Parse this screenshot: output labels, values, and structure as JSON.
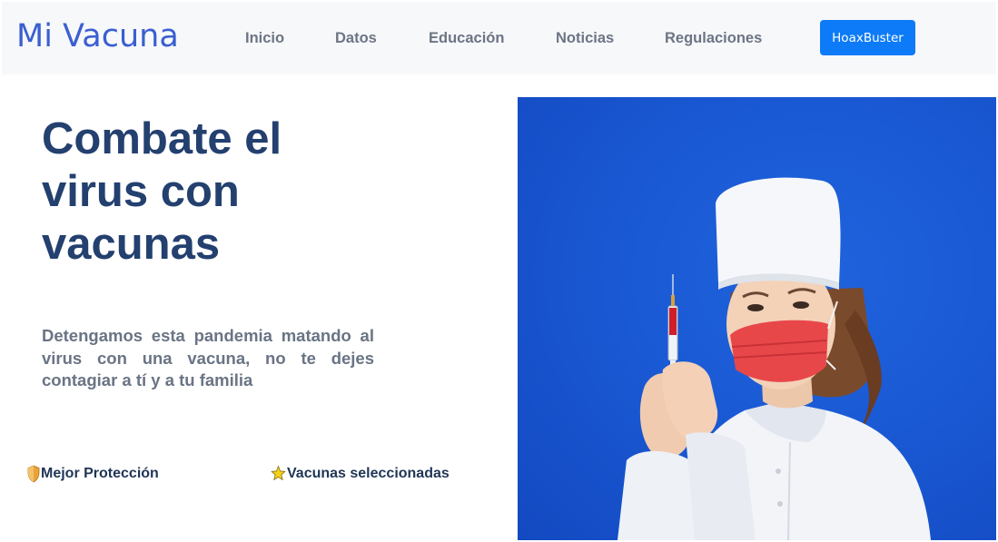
{
  "nav": {
    "brand": "Mi Vacuna",
    "links": [
      "Inicio",
      "Datos",
      "Educación",
      "Noticias",
      "Regulaciones"
    ],
    "cta": "HoaxBuster"
  },
  "hero": {
    "title": "Combate el virus con vacunas",
    "description": "Detengamos esta pandemia matando al virus con una vacuna, no te dejes contagiar a tí y a tu familia",
    "features": [
      {
        "icon": "shield-icon",
        "label": "Mejor Protección"
      },
      {
        "icon": "star-icon",
        "label": "Vacunas seleccionadas"
      }
    ]
  },
  "colors": {
    "brand": "#3a5fd0",
    "title": "#23406f",
    "cta": "#0d7bf8",
    "image_bg": "#1a59d4"
  }
}
